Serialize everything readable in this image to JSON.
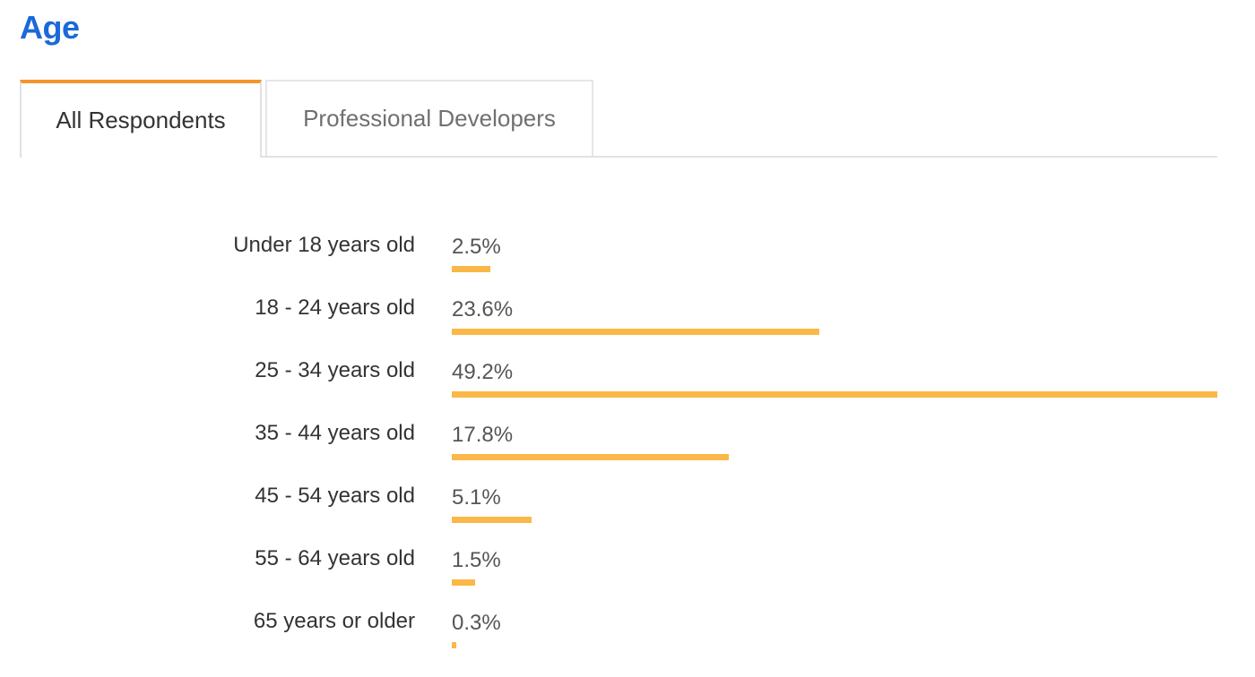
{
  "page": {
    "title": "Age"
  },
  "tabs": [
    {
      "label": "All Respondents",
      "active": true
    },
    {
      "label": "Professional Developers",
      "active": false
    }
  ],
  "colors": {
    "title": "#1a6ad8",
    "active_tab_accent": "#f4962a",
    "bar": "#fab848"
  },
  "chart_data": {
    "type": "bar",
    "orientation": "horizontal",
    "categories": [
      "Under 18 years old",
      "18 - 24 years old",
      "25 - 34 years old",
      "35 - 44 years old",
      "45 - 54 years old",
      "55 - 64 years old",
      "65 years or older"
    ],
    "values": [
      2.5,
      23.6,
      49.2,
      17.8,
      5.1,
      1.5,
      0.3
    ],
    "value_labels": [
      "2.5%",
      "23.6%",
      "49.2%",
      "17.8%",
      "5.1%",
      "1.5%",
      "0.3%"
    ],
    "unit": "%",
    "xlim": [
      0,
      49.2
    ],
    "grid": false,
    "legend": "none"
  }
}
